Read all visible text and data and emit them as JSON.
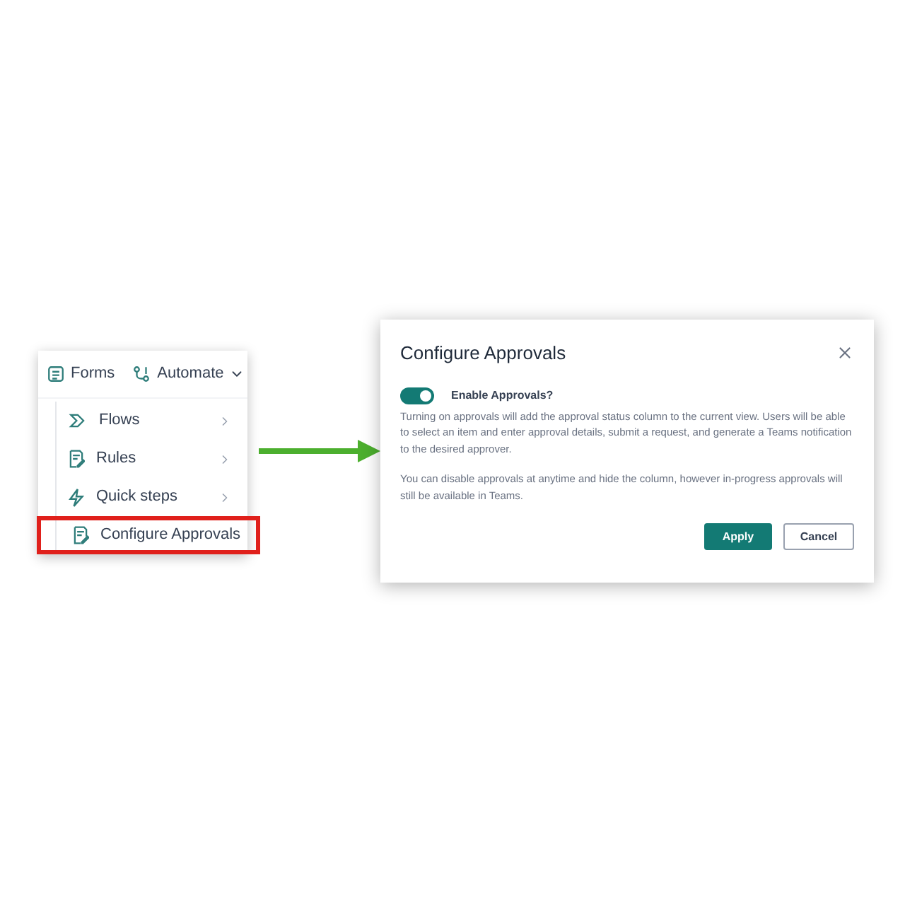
{
  "toolbar": {
    "items": [
      {
        "label": "Forms",
        "kind": "forms"
      },
      {
        "label": "Automate",
        "kind": "automate"
      }
    ]
  },
  "menu": {
    "items": [
      {
        "label": "Flows",
        "kind": "flows",
        "submenu": true,
        "highlighted": false
      },
      {
        "label": "Rules",
        "kind": "rules",
        "submenu": true,
        "highlighted": false
      },
      {
        "label": "Quick steps",
        "kind": "quick",
        "submenu": true,
        "highlighted": false
      },
      {
        "label": "Configure Approvals",
        "kind": "rules",
        "submenu": false,
        "highlighted": true
      }
    ]
  },
  "dialog": {
    "title": "Configure Approvals",
    "toggle": {
      "label": "Enable Approvals?",
      "on": true
    },
    "paragraphs": [
      "Turning on approvals will add the approval status column to the current view. Users will be able to select an item and enter approval details, submit a request, and generate a Teams notification to the desired approver.",
      "You can disable approvals at anytime and hide the column, however in-progress approvals will still be available in Teams."
    ],
    "buttons": [
      {
        "label": "Apply",
        "kind": "primary"
      },
      {
        "label": "Cancel",
        "kind": "secondary"
      }
    ]
  }
}
